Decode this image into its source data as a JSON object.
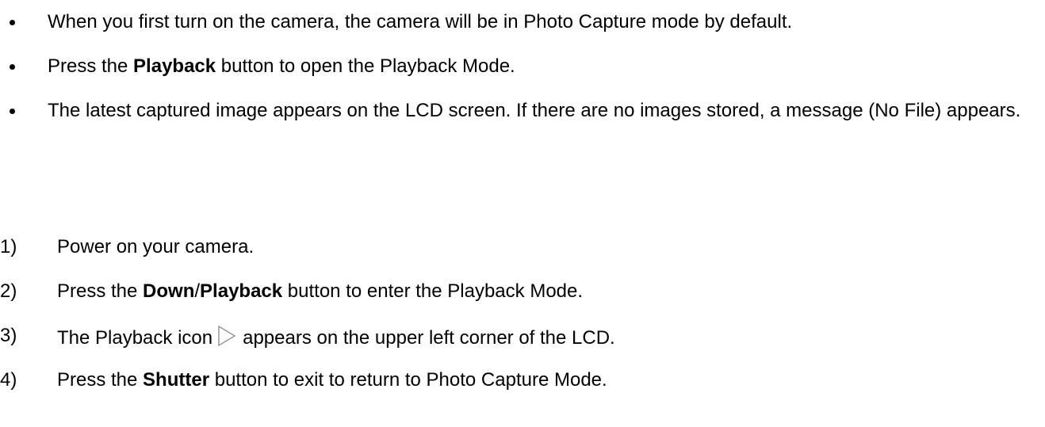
{
  "bullets": [
    {
      "text": "When you first turn on the camera, the camera will be in Photo Capture mode by default."
    },
    {
      "pre": "Press the ",
      "bold": "Playback",
      "post": " button to open the Playback Mode."
    },
    {
      "text": "The latest captured image appears on the LCD screen. If there are no images stored, a message (No File) appears."
    }
  ],
  "steps": [
    {
      "num": "1)",
      "text": "Power on your camera."
    },
    {
      "num": "2)",
      "pre": "Press the ",
      "bold1": "Down",
      "sep": "/",
      "bold2": "Playback",
      "post": " button to enter the Playback Mode."
    },
    {
      "num": "3)",
      "pre": "The Playback icon",
      "icon": "playback-triangle-icon",
      "post": "appears on the upper left corner of the LCD."
    },
    {
      "num": "4)",
      "pre": "Press the ",
      "bold": "Shutter",
      "post": " button to exit to return to Photo Capture Mode."
    }
  ]
}
